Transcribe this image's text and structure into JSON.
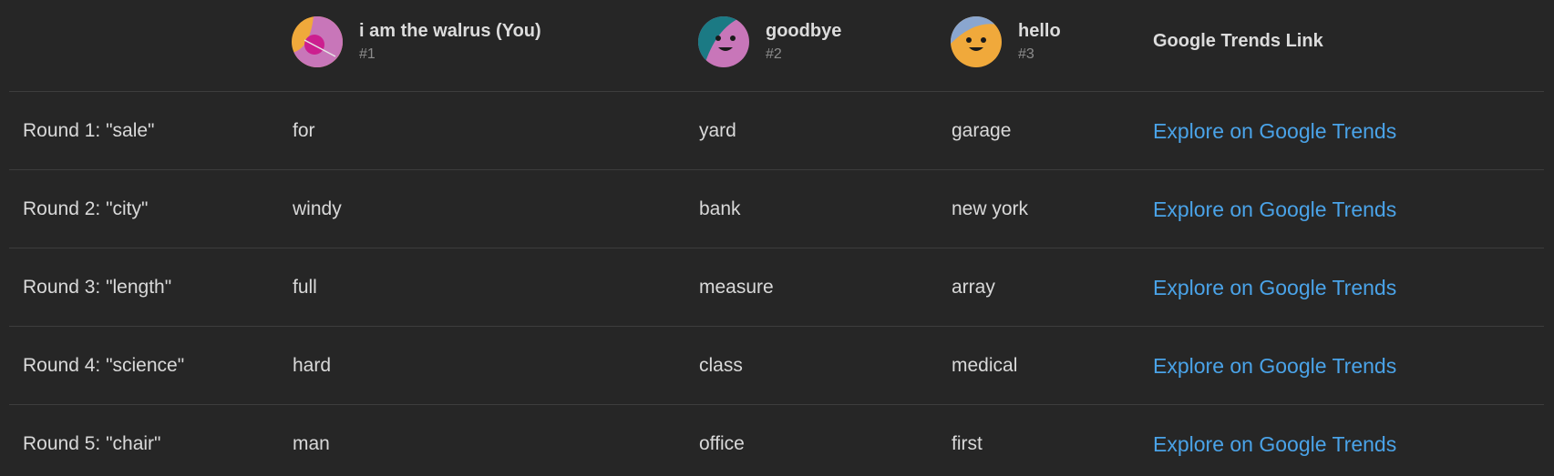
{
  "players": [
    {
      "name": "i am the walrus (You)",
      "rank": "#1",
      "avatar": "orange-pink-avatar-icon"
    },
    {
      "name": "goodbye",
      "rank": "#2",
      "avatar": "teal-pink-smiley-avatar-icon"
    },
    {
      "name": "hello",
      "rank": "#3",
      "avatar": "orange-smiley-avatar-icon"
    }
  ],
  "header": {
    "trends_label": "Google Trends Link"
  },
  "rows": [
    {
      "round": "Round 1: \"sale\"",
      "p1": "for",
      "p2": "yard",
      "p3": "garage",
      "link": "Explore on Google Trends"
    },
    {
      "round": "Round 2: \"city\"",
      "p1": "windy",
      "p2": "bank",
      "p3": "new york",
      "link": "Explore on Google Trends"
    },
    {
      "round": "Round 3: \"length\"",
      "p1": "full",
      "p2": "measure",
      "p3": "array",
      "link": "Explore on Google Trends"
    },
    {
      "round": "Round 4: \"science\"",
      "p1": "hard",
      "p2": "class",
      "p3": "medical",
      "link": "Explore on Google Trends"
    },
    {
      "round": "Round 5: \"chair\"",
      "p1": "man",
      "p2": "office",
      "p3": "first",
      "link": "Explore on Google Trends"
    }
  ],
  "colors": {
    "background": "#262626",
    "link": "#4aa3e8",
    "divider": "#3d3d3d",
    "avatar_orange": "#f0a93b",
    "avatar_pink": "#c876b9",
    "avatar_magenta": "#cc1f8f",
    "avatar_teal": "#1b7a84",
    "avatar_blue": "#8aa6cf"
  }
}
